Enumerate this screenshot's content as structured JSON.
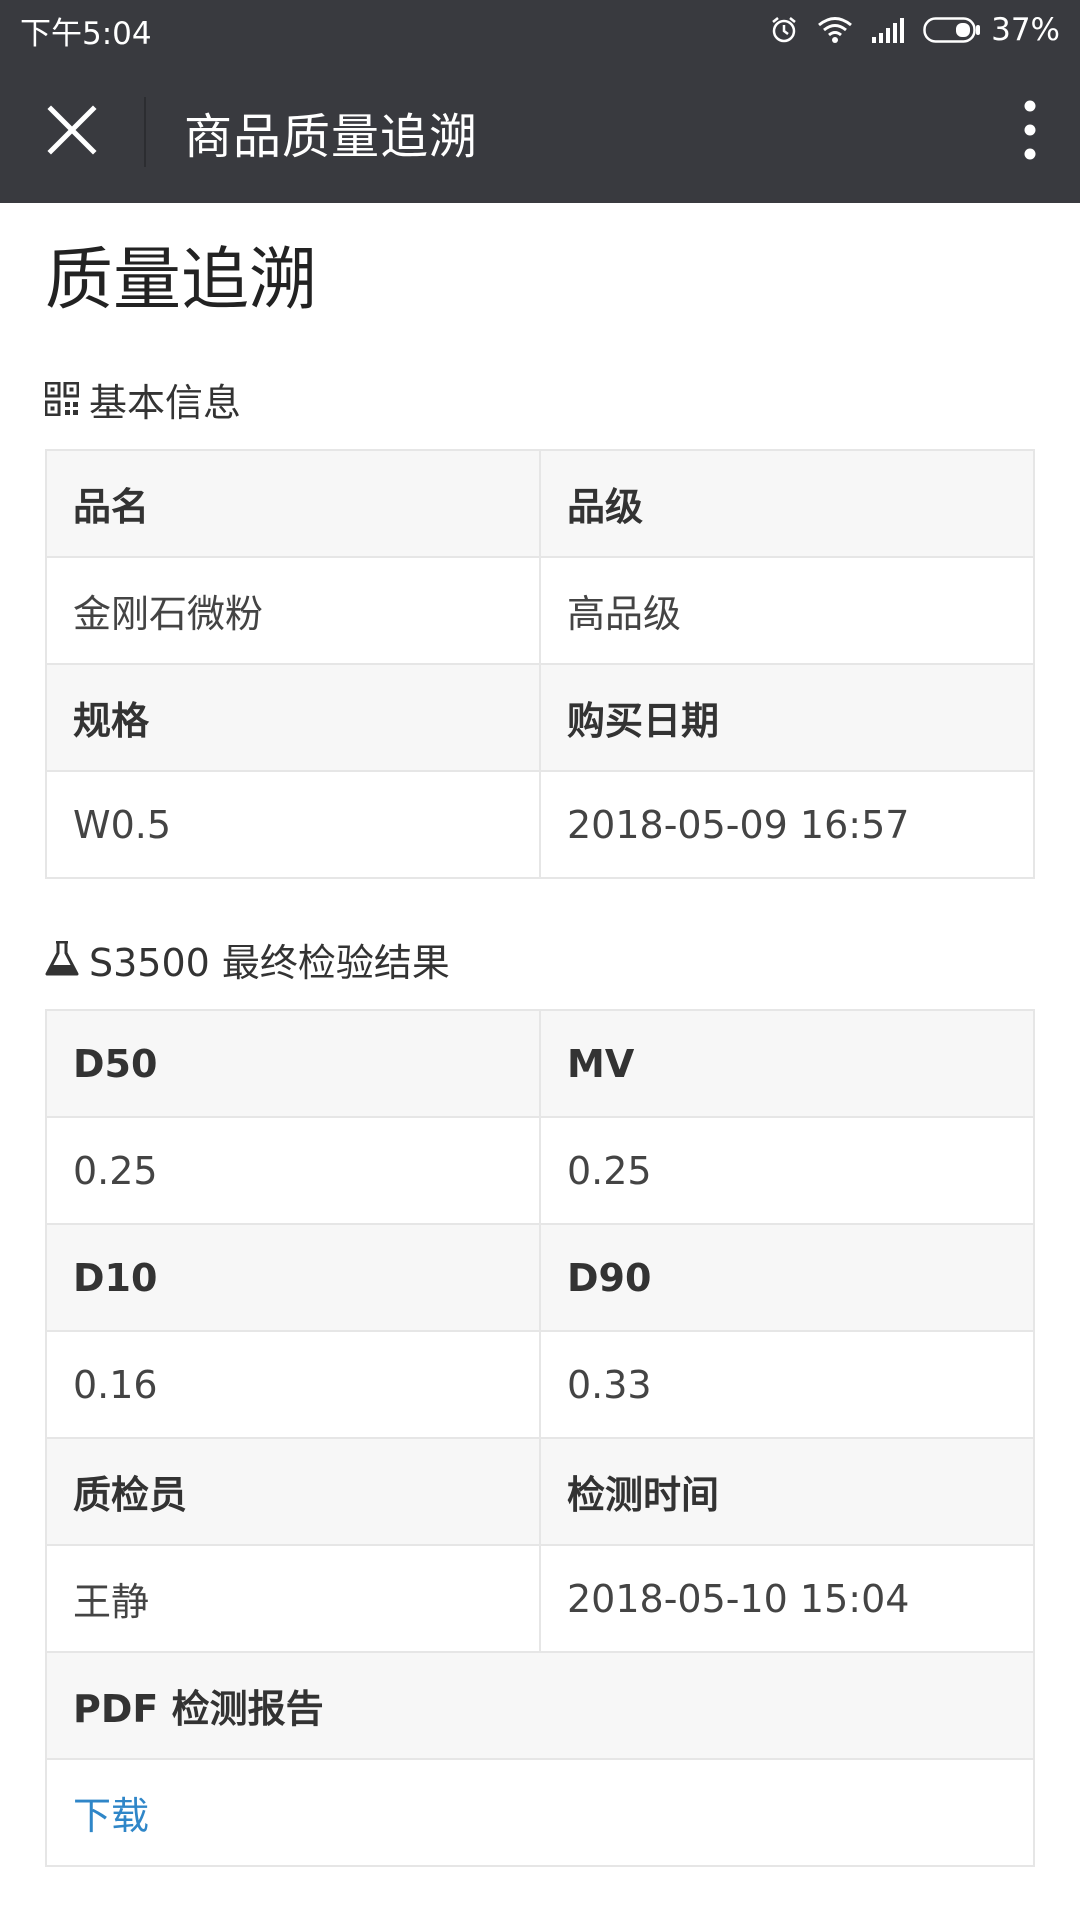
{
  "status_bar": {
    "time": "下午5:04",
    "battery": "37%",
    "icons": [
      "alarm-icon",
      "wifi-icon",
      "signal-icon",
      "battery-icon"
    ]
  },
  "nav": {
    "title": "商品质量追溯",
    "close_icon": "close-icon",
    "more_icon": "more-vertical-icon"
  },
  "page": {
    "title": "质量追溯"
  },
  "basic_info": {
    "heading": "基本信息",
    "icon": "qrcode-icon",
    "rows": [
      {
        "type": "header",
        "cells": [
          "品名",
          "品级"
        ]
      },
      {
        "type": "value",
        "cells": [
          "金刚石微粉",
          "高品级"
        ]
      },
      {
        "type": "header",
        "cells": [
          "规格",
          "购买日期"
        ]
      },
      {
        "type": "value",
        "cells": [
          "W0.5",
          "2018-05-09 16:57"
        ]
      }
    ]
  },
  "inspection": {
    "heading": "S3500 最终检验结果",
    "icon": "flask-icon",
    "rows": [
      {
        "type": "header",
        "cells": [
          "D50",
          "MV"
        ]
      },
      {
        "type": "value",
        "cells": [
          "0.25",
          "0.25"
        ]
      },
      {
        "type": "header",
        "cells": [
          "D10",
          "D90"
        ]
      },
      {
        "type": "value",
        "cells": [
          "0.16",
          "0.33"
        ]
      },
      {
        "type": "header",
        "cells": [
          "质检员",
          "检测时间"
        ]
      },
      {
        "type": "value",
        "cells": [
          "王静",
          "2018-05-10 15:04"
        ]
      }
    ],
    "report_header": "PDF 检测报告",
    "download_label": "下载"
  },
  "colors": {
    "bar_bg": "#393a3f",
    "header_cell_bg": "#f7f7f7",
    "border": "#e6e6e6",
    "link": "#2f86c8"
  }
}
